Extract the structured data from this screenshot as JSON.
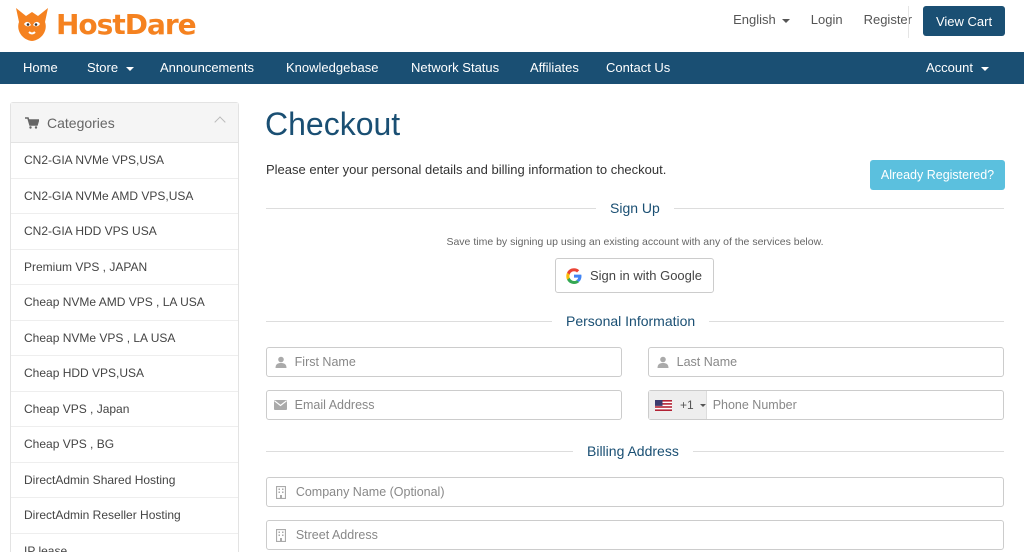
{
  "brand": {
    "name_part1": "Host",
    "name_part2": "Dare"
  },
  "header": {
    "language": "English",
    "login": "Login",
    "register": "Register",
    "view_cart": "View Cart"
  },
  "nav": {
    "items": [
      "Home",
      "Store",
      "Announcements",
      "Knowledgebase",
      "Network Status",
      "Affiliates",
      "Contact Us"
    ],
    "account": "Account"
  },
  "sidebar": {
    "title": "Categories",
    "items": [
      "CN2-GIA NVMe VPS,USA",
      "CN2-GIA NVMe AMD VPS,USA",
      "CN2-GIA HDD VPS USA",
      "Premium VPS , JAPAN",
      "Cheap NVMe AMD VPS , LA USA",
      "Cheap NVMe VPS , LA USA",
      "Cheap HDD VPS,USA",
      "Cheap VPS , Japan",
      "Cheap VPS , BG",
      "DirectAdmin Shared Hosting",
      "DirectAdmin Reseller Hosting",
      "IP lease"
    ]
  },
  "main": {
    "title": "Checkout",
    "intro": "Please enter your personal details and billing information to checkout.",
    "already_registered": "Already Registered?",
    "signup_title": "Sign Up",
    "signup_note": "Save time by signing up using an existing account with any of the services below.",
    "google_label": "Sign in with Google",
    "personal_title": "Personal Information",
    "billing_title": "Billing Address",
    "fields": {
      "first_name": "First Name",
      "last_name": "Last Name",
      "email": "Email Address",
      "phone_code": "+1",
      "phone": "Phone Number",
      "company": "Company Name (Optional)",
      "street": "Street Address"
    }
  },
  "colors": {
    "brand_orange": "#f58220",
    "nav_blue": "#1a4f73",
    "info_button": "#5bc0de"
  }
}
